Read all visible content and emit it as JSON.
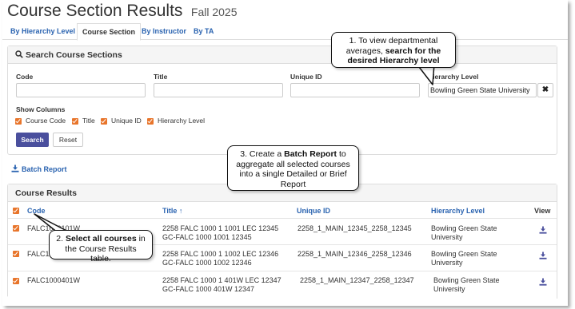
{
  "header": {
    "title": "Course Section Results",
    "term": "Fall 2025"
  },
  "tabs": [
    {
      "label": "By Hierarchy Level"
    },
    {
      "label": "Course Section"
    },
    {
      "label": "By Instructor"
    },
    {
      "label": "By TA"
    }
  ],
  "search": {
    "panel_title": "Search Course Sections",
    "code_label": "Code",
    "title_label": "Title",
    "unique_id_label": "Unique ID",
    "hierarchy_label": "Hierarchy Level",
    "code_value": "",
    "title_value": "",
    "unique_id_value": "",
    "hierarchy_value": "Bowling Green State University",
    "clear_icon": "✖",
    "show_columns_label": "Show Columns",
    "columns": [
      {
        "label": "Course Code",
        "checked": true
      },
      {
        "label": "Title",
        "checked": true
      },
      {
        "label": "Unique ID",
        "checked": true
      },
      {
        "label": "Hierarchy Level",
        "checked": true
      }
    ],
    "search_button": "Search",
    "reset_button": "Reset"
  },
  "batch_report": {
    "label": "Batch Report",
    "icon": "download-icon"
  },
  "results": {
    "panel_title": "Course Results",
    "headers": {
      "code": "Code",
      "title": "Title ↑",
      "unique_id": "Unique ID",
      "hierarchy": "Hierarchy Level",
      "view": "View"
    },
    "rows": [
      {
        "code": "FALC1000101W",
        "title": "2258 FALC 1000 1 1001 LEC 12345 GC-FALC 1000 1001 12345",
        "unique_id": "2258_1_MAIN_12345_2258_12345",
        "hierarchy": "Bowling Green State University"
      },
      {
        "code": "FALC1000102W",
        "title": "2258 FALC 1000 1 1002 LEC 12346 GC-FALC 1000 1002 12346",
        "unique_id": "2258_1_MAIN_12346_2258_12346",
        "hierarchy": "Bowling Green State University"
      },
      {
        "code": "FALC1000401W",
        "title": "2258 FALC 1000 1 401W LEC 12347 GC-FALC 1000 401W 12347",
        "unique_id": "2258_1_MAIN_12347_2258_12347",
        "hierarchy": "Bowling Green State University"
      }
    ]
  },
  "callouts": {
    "c1_pre": "1. To view departmental averages, ",
    "c1_bold": "search for the desired Hierarchy level",
    "c2_pre": "2. ",
    "c2_bold": "Select all courses",
    "c2_post": " in the Course Results table.",
    "c3_pre": "3. Create a ",
    "c3_bold": "Batch Report",
    "c3_post": " to aggregate all selected courses into a single Detailed or Brief Report"
  },
  "colors": {
    "accent": "#4a4f9d",
    "link": "#2a63b0",
    "checkbox": "#e8752b"
  }
}
